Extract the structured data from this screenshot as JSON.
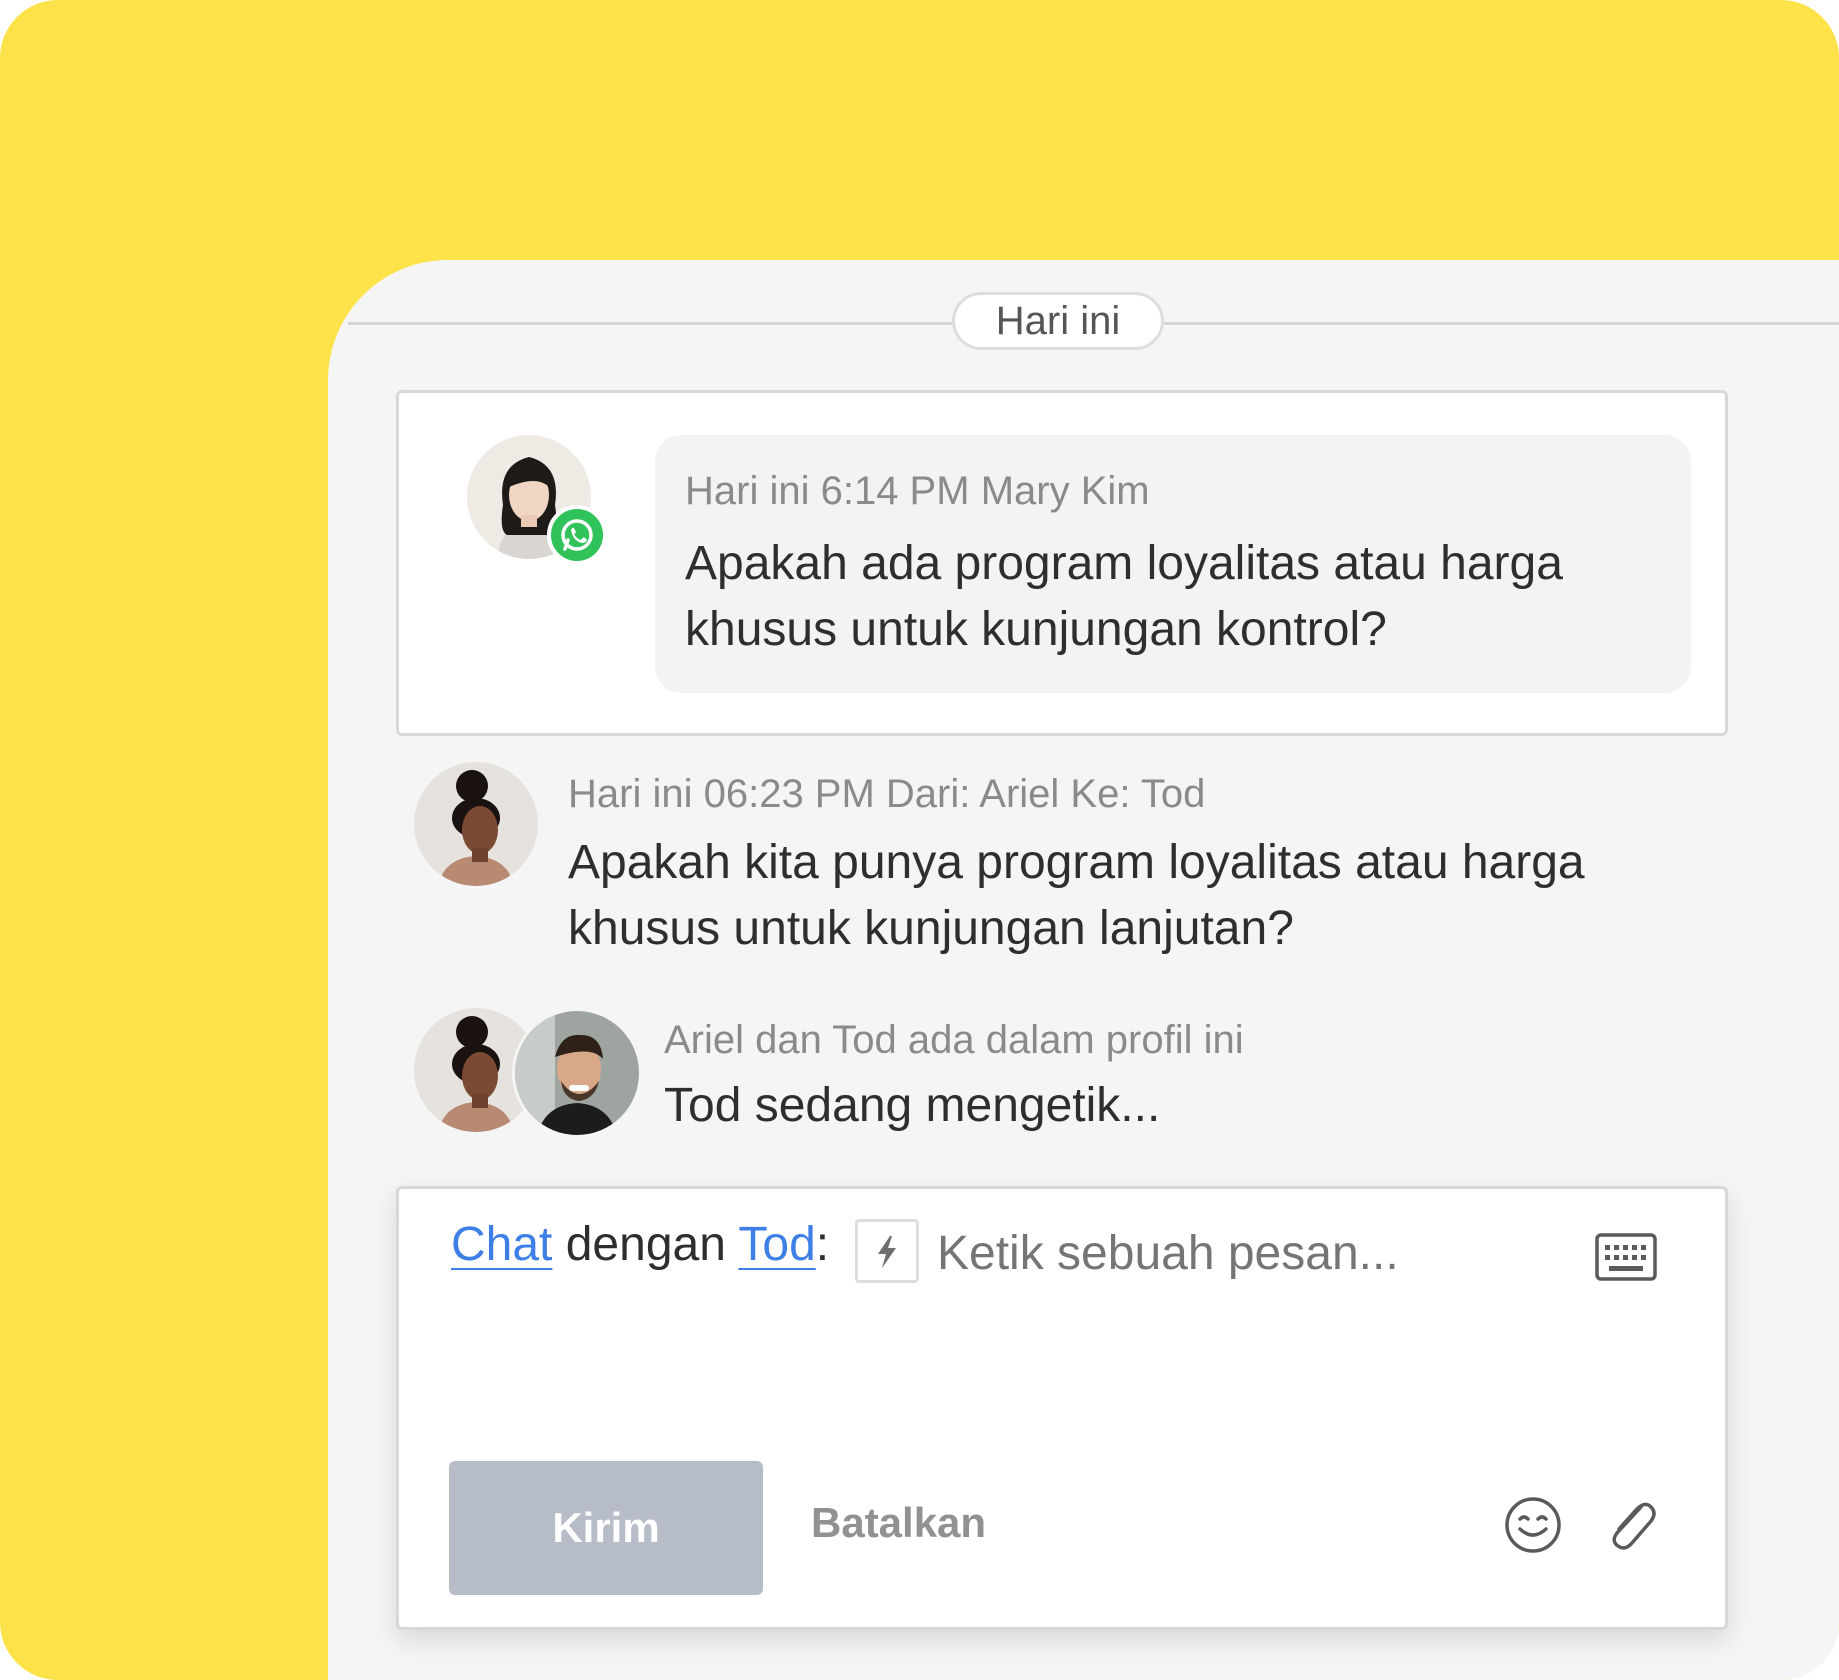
{
  "date_divider": "Hari ini",
  "messages": [
    {
      "timestamp": "Hari ini 6:14 PM",
      "sender": "Mary Kim",
      "channel_icon": "whatsapp-icon",
      "text_line1": "Apakah ada program loyalitas atau harga",
      "text_line2": "khusus untuk kunjungan kontrol?"
    },
    {
      "timestamp": "Hari ini 06:23 PM",
      "route": "Dari: Ariel Ke: Tod",
      "text_line1": "Apakah kita punya program loyalitas atau harga",
      "text_line2": "khusus untuk kunjungan lanjutan?"
    }
  ],
  "presence": {
    "info": "Ariel dan Tod ada dalam profil ini",
    "typing": "Tod sedang mengetik..."
  },
  "compose": {
    "mode_link": "Chat",
    "with_text": "dengan",
    "recipient_link": "Tod",
    "colon": ":",
    "placeholder": "Ketik sebuah pesan...",
    "send_label": "Kirim",
    "cancel_label": "Batalkan"
  },
  "colors": {
    "background": "#FEE24A",
    "link": "#3D7FE6",
    "whatsapp": "#2FC35A",
    "send_button": "#B6BDC8"
  }
}
